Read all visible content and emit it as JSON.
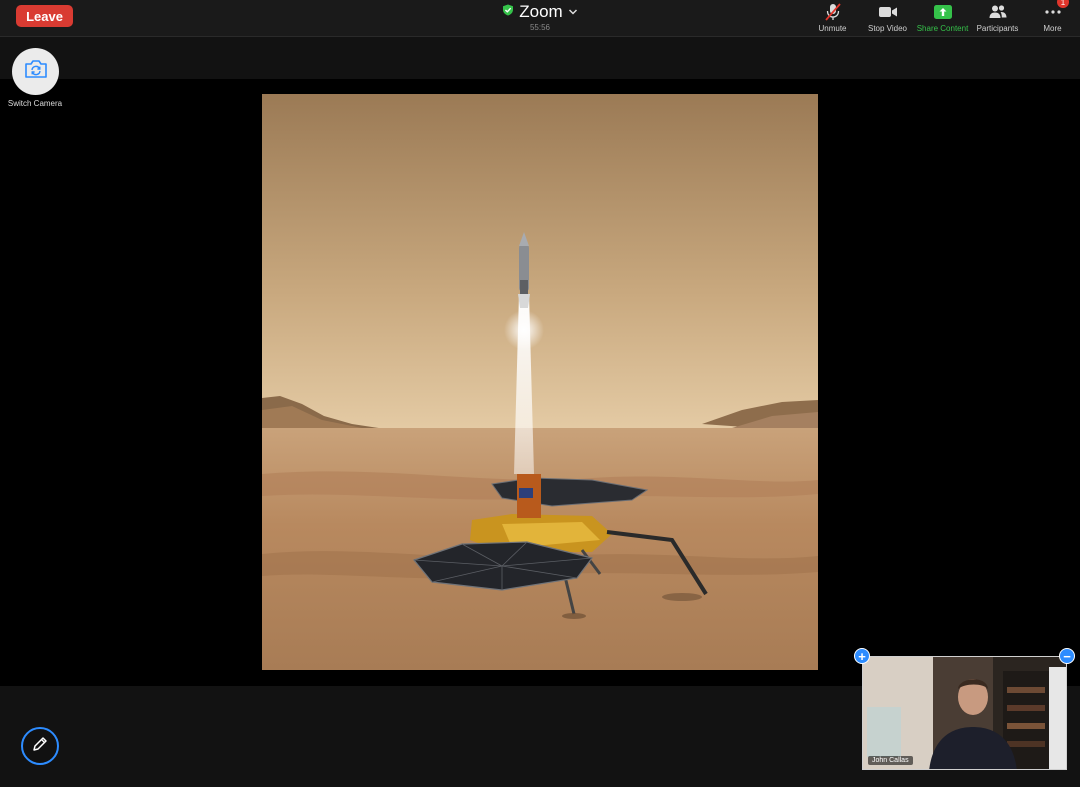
{
  "window": {
    "title": "Zoom",
    "timer": "55:56"
  },
  "header": {
    "leave_label": "Leave"
  },
  "toolbar": [
    {
      "label": "Unmute",
      "icon": "mic-muted-icon"
    },
    {
      "label": "Stop Video",
      "icon": "video-camera-icon"
    },
    {
      "label": "Share Content",
      "icon": "share-screen-icon"
    },
    {
      "label": "Participants",
      "icon": "participants-icon"
    },
    {
      "label": "More",
      "icon": "more-dots-icon",
      "badge": "1"
    }
  ],
  "camera": {
    "switch_label": "Switch Camera"
  },
  "self_view": {
    "participant_name": "John Callas"
  },
  "colors": {
    "leave_red": "#d93b32",
    "share_green": "#35c24a",
    "accent_blue": "#2d8cff"
  }
}
